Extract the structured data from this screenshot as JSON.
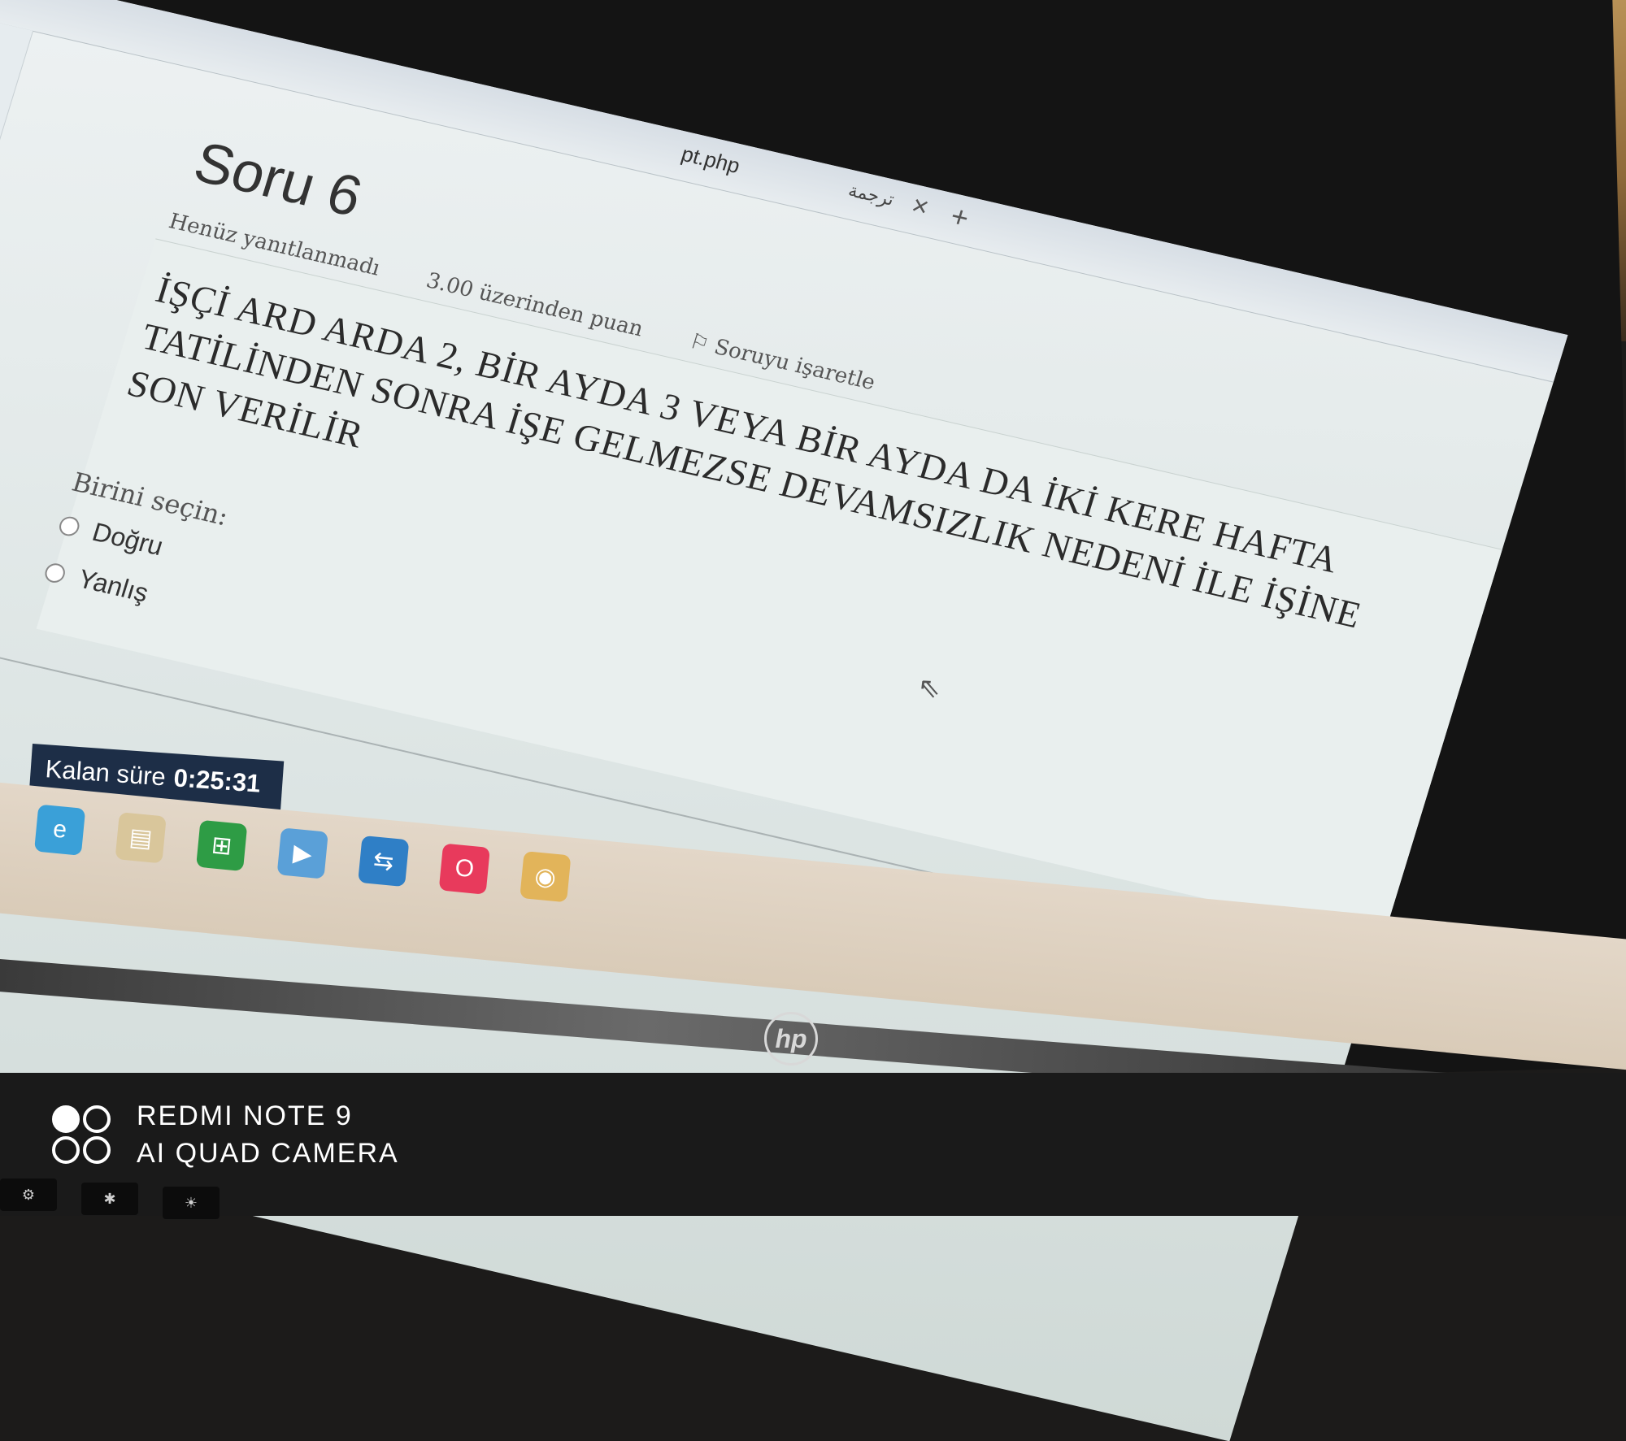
{
  "browser": {
    "tab_title": "pt.php",
    "tab_translate": "ترجمة",
    "close_glyph": "×",
    "new_tab_glyph": "+"
  },
  "sidebar": {
    "items": [
      {
        "icon": "messenger-icon",
        "color": "#7b5cff"
      },
      {
        "icon": "whatsapp-icon",
        "color": "#25d366"
      },
      {
        "icon": "telegram-icon",
        "color": "#2ca5e0"
      },
      {
        "icon": "instagram-icon",
        "color": "#d6306a"
      },
      {
        "icon": "play-icon"
      },
      {
        "icon": "send-icon"
      },
      {
        "icon": "heart-icon"
      },
      {
        "icon": "clock-icon"
      },
      {
        "icon": "settings-icon"
      }
    ]
  },
  "question": {
    "heading": "Soru 6",
    "status": "Henüz yanıtlanmadı",
    "points": "3.00 üzerinden puan",
    "flag_label": "Soruyu işaretle",
    "text": "İŞÇİ ARD ARDA 2, BİR AYDA 3 VEYA BİR AYDA DA İKİ KERE HAFTA TATİLİNDEN SONRA İŞE GELMEZSE DEVAMSIZLIK NEDENİ İLE İŞİNE SON VERİLİR",
    "prompt": "Birini seçin:",
    "options": [
      {
        "label": "Doğru",
        "selected": false
      },
      {
        "label": "Yanlış",
        "selected": false
      }
    ]
  },
  "timer": {
    "label": "Kalan süre",
    "value": "0:25:31",
    "color": "#1d2e47"
  },
  "taskbar": {
    "icons": [
      "edge-icon",
      "file-explorer-icon",
      "store-icon",
      "zoom-icon",
      "teamviewer-icon",
      "opera-icon",
      "chrome-icon"
    ]
  },
  "laptop": {
    "logo_text": "hp"
  },
  "watermark": {
    "line1": "REDMI NOTE 9",
    "line2": "AI QUAD CAMERA"
  }
}
